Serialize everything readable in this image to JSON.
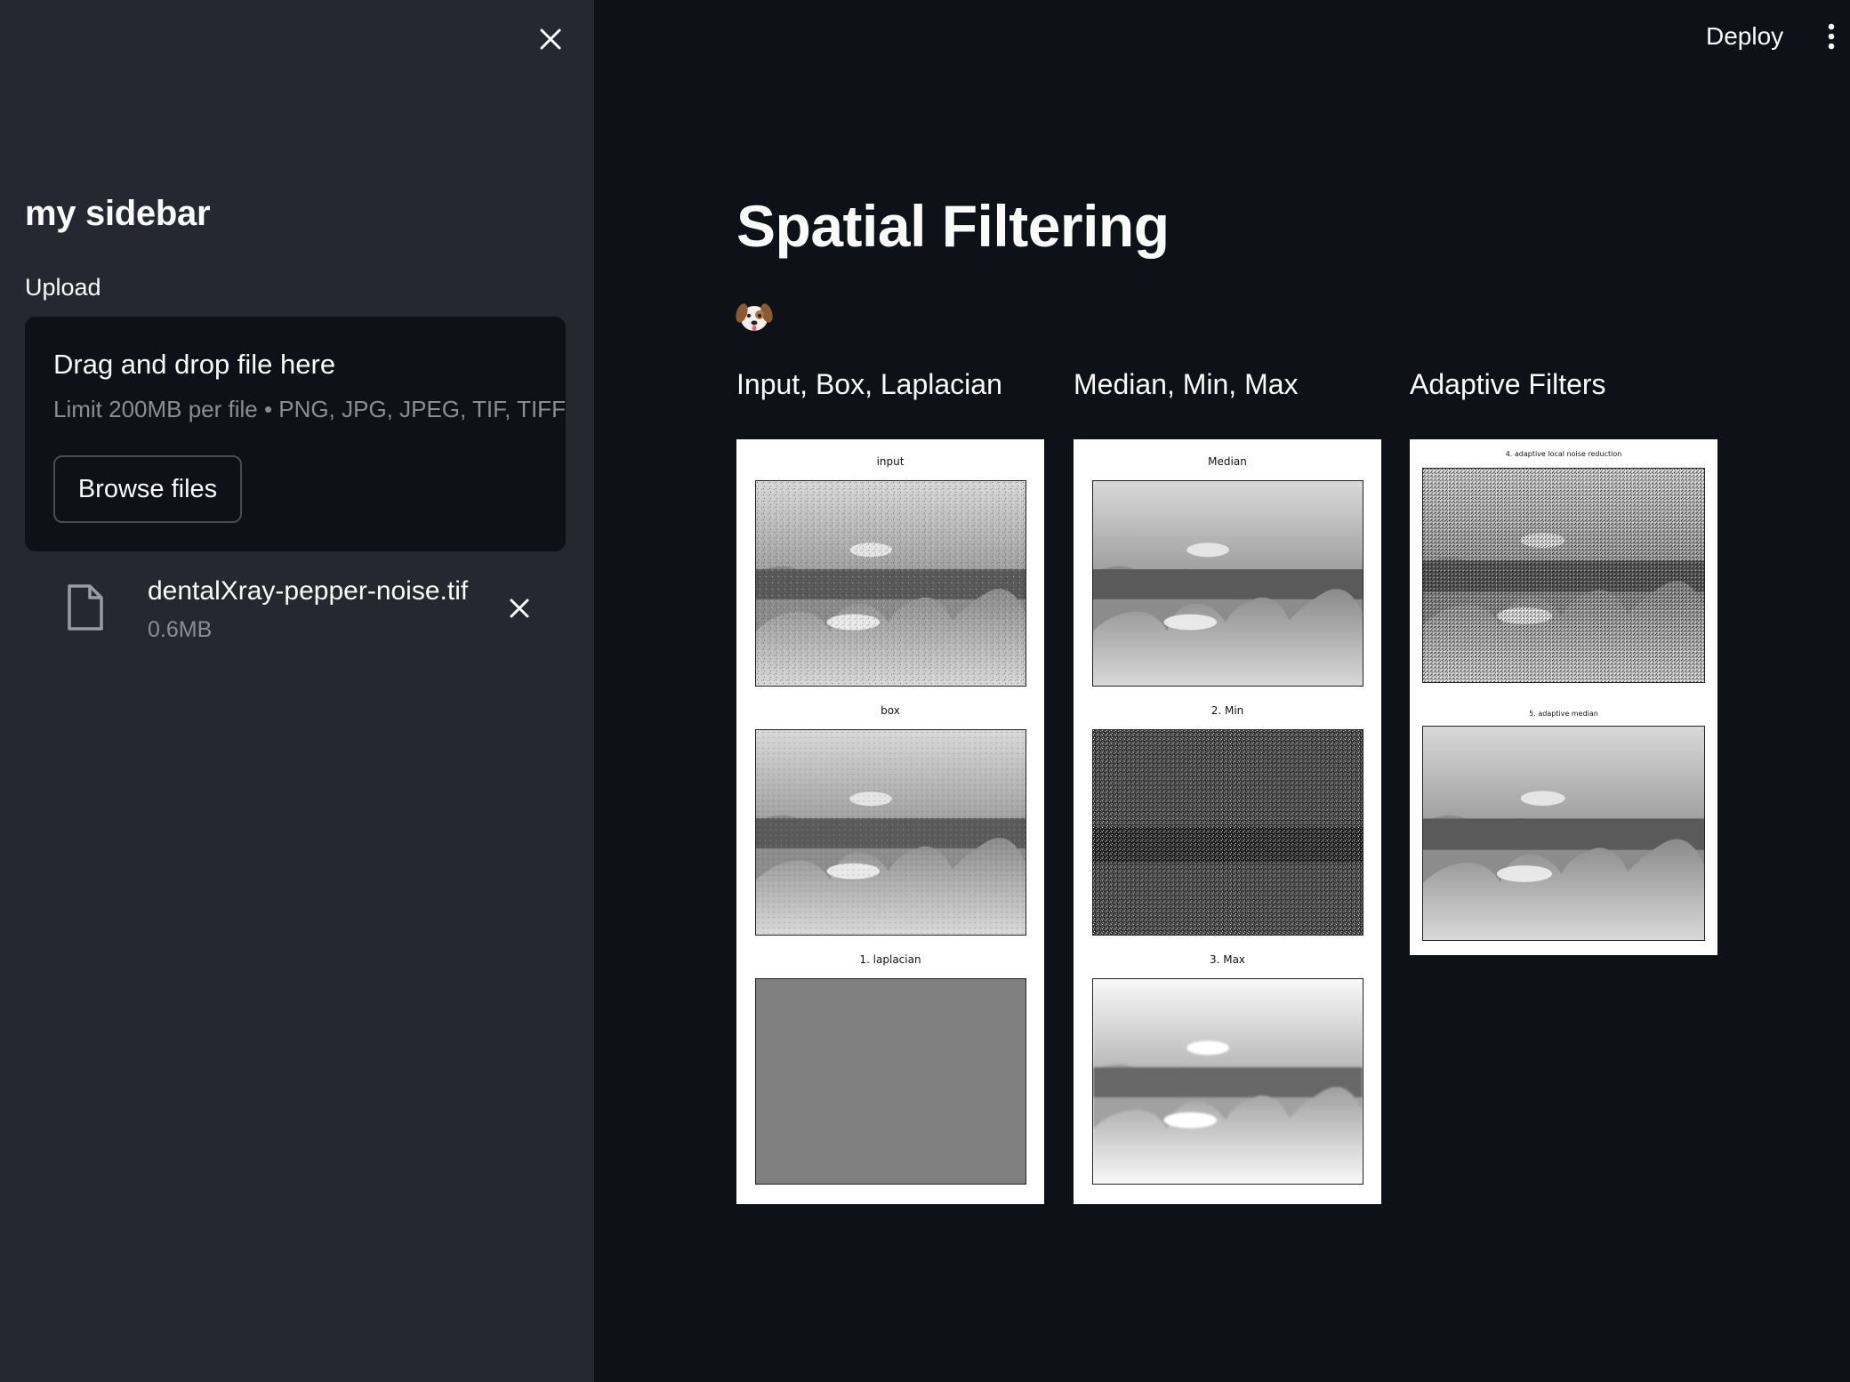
{
  "sidebar": {
    "title": "my sidebar",
    "upload": {
      "label": "Upload",
      "drop_text": "Drag and drop file here",
      "limit_text": "Limit 200MB per file • PNG, JPG, JPEG, TIF, TIFF",
      "browse_label": "Browse files"
    },
    "file": {
      "name": "dentalXray-pepper-noise.tif",
      "size": "0.6MB"
    }
  },
  "header": {
    "deploy_label": "Deploy"
  },
  "main": {
    "title": "Spatial Filtering",
    "emoji": "🐶",
    "columns": [
      {
        "header": "Input, Box, Laplacian",
        "panels": [
          {
            "caption": "input",
            "kind": "noisy"
          },
          {
            "caption": "box",
            "kind": "smooth-noisy"
          },
          {
            "caption": "1. laplacian",
            "kind": "flat-gray"
          }
        ]
      },
      {
        "header": "Median, Min, Max",
        "panels": [
          {
            "caption": "Median",
            "kind": "clean"
          },
          {
            "caption": "2. Min",
            "kind": "dark-noise"
          },
          {
            "caption": "3. Max",
            "kind": "bright-blur"
          }
        ]
      },
      {
        "header": "Adaptive Filters",
        "panels": [
          {
            "caption": "4. adaptive local noise reduction",
            "kind": "heavy-noise"
          },
          {
            "caption": "5. adaptive median",
            "kind": "clean"
          }
        ]
      }
    ]
  },
  "colors": {
    "app_bg": "#0e1117",
    "sidebar_bg": "#262730",
    "text": "#fafafa",
    "muted_text": "#8b8d96"
  }
}
